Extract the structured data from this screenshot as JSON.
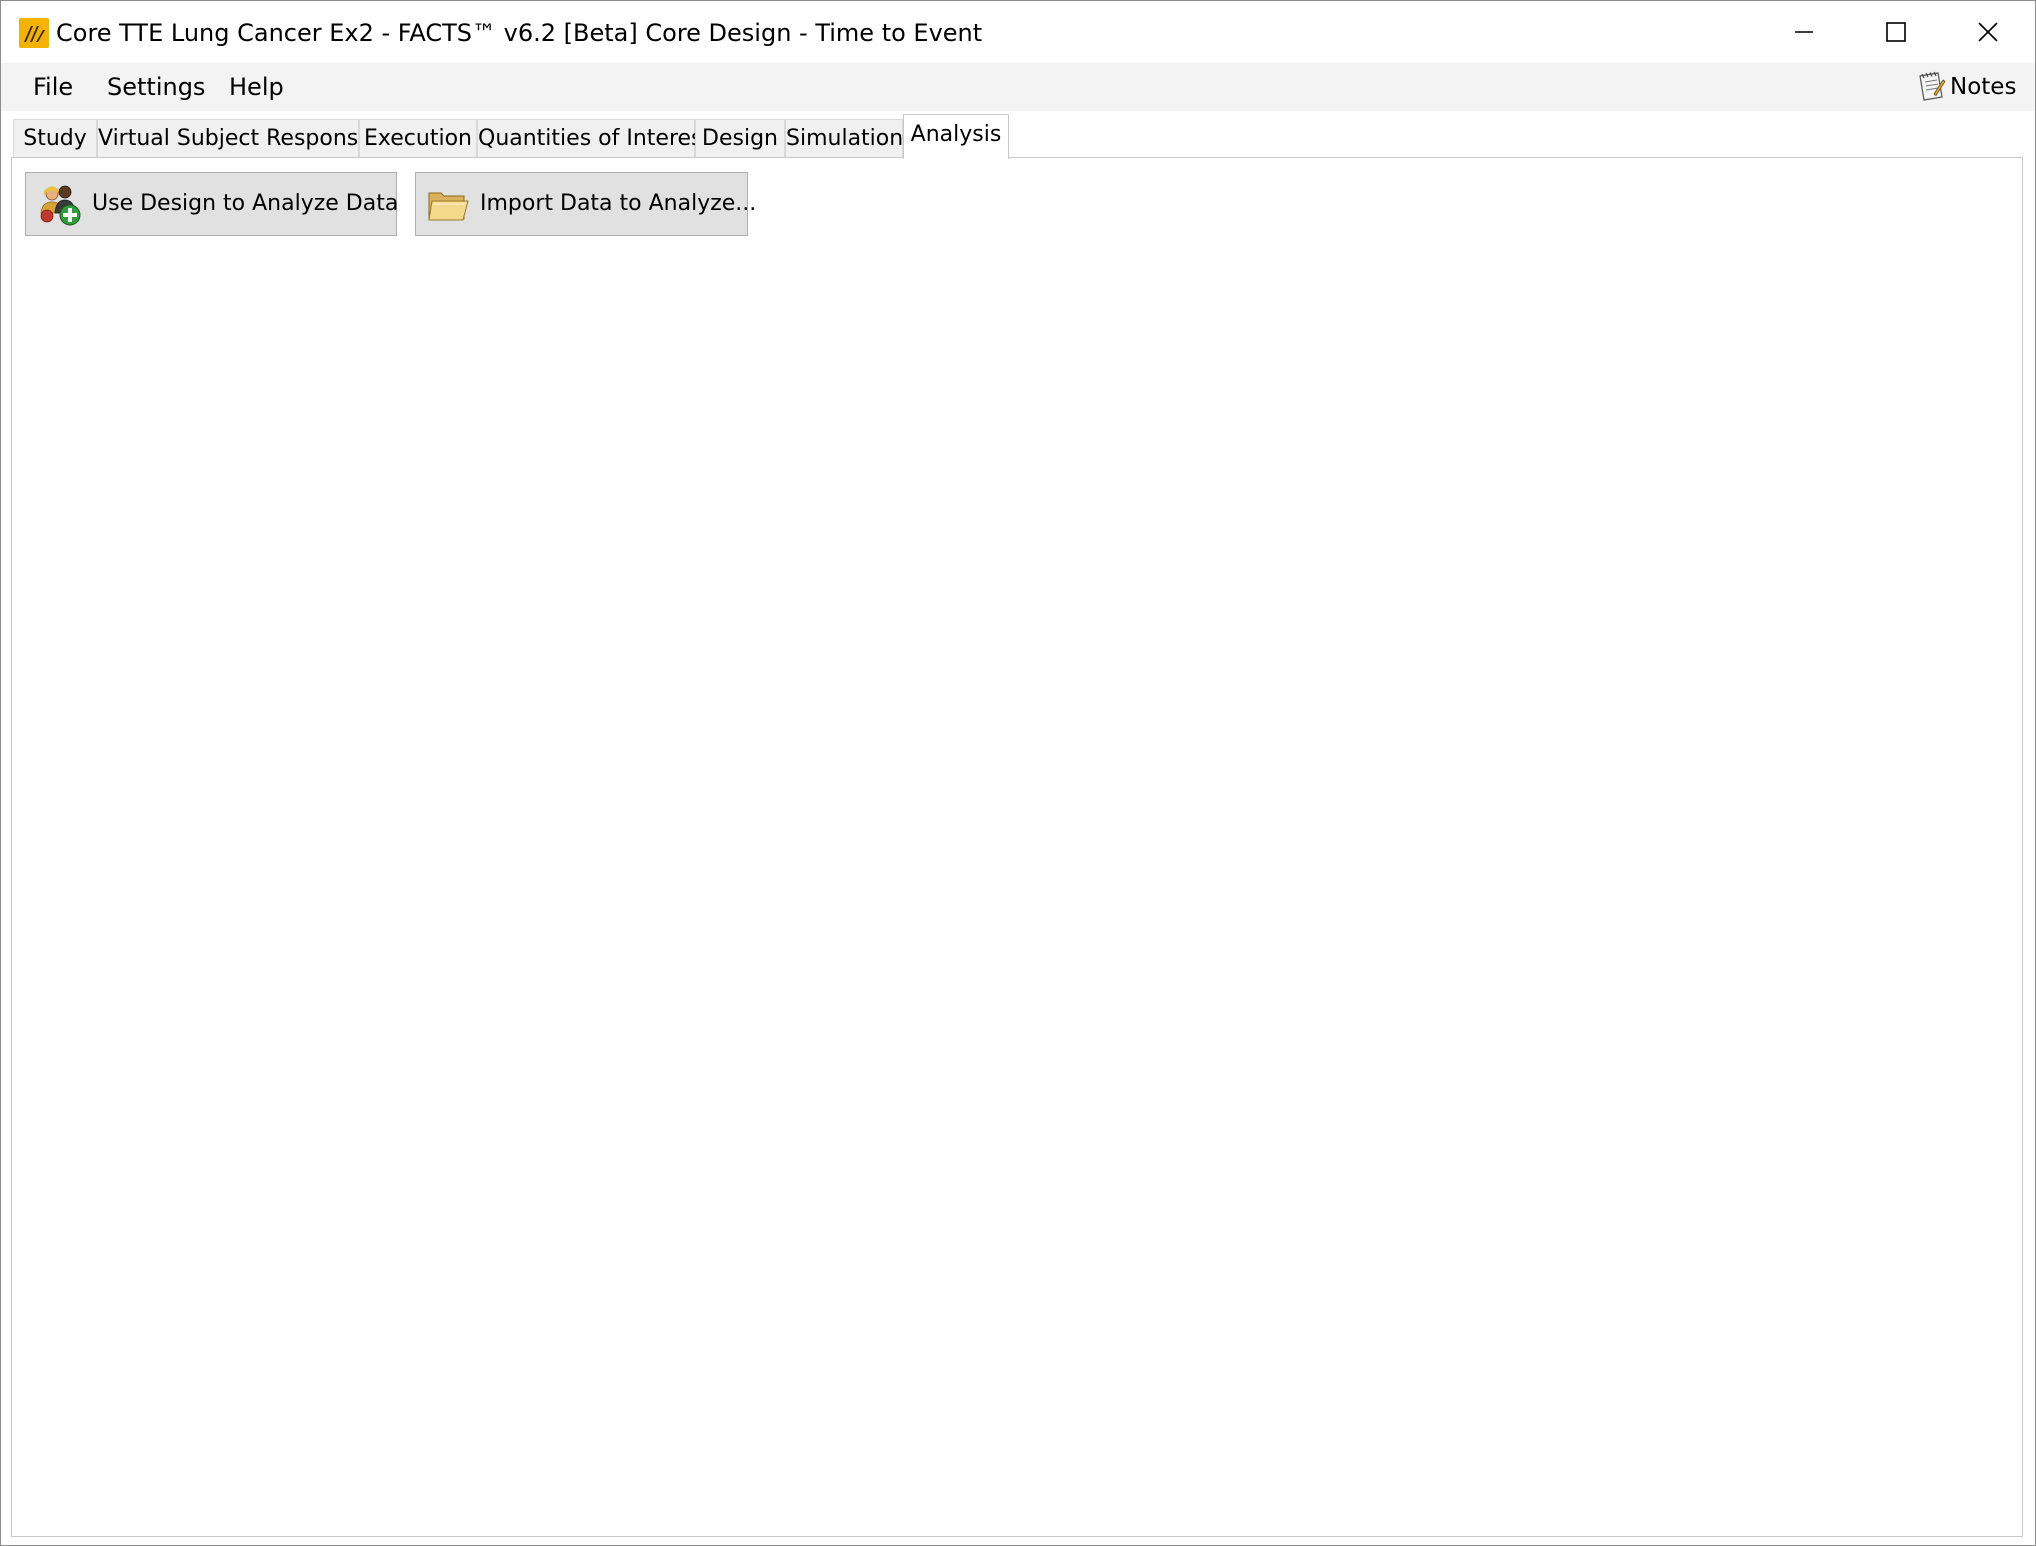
{
  "window": {
    "title": "Core TTE Lung Cancer Ex2 - FACTS™ v6.2 [Beta] Core Design - Time to Event",
    "icon": "facts-app-icon",
    "controls": [
      "minimize-icon",
      "maximize-icon",
      "close-icon"
    ]
  },
  "menu": {
    "items": [
      {
        "label": "File"
      },
      {
        "label": "Settings"
      },
      {
        "label": "Help"
      }
    ],
    "notes_label": "Notes",
    "notes_icon": "notepad-icon"
  },
  "tabs": [
    {
      "label": "Study",
      "active": false
    },
    {
      "label": "Virtual Subject Response",
      "active": false
    },
    {
      "label": "Execution",
      "active": false
    },
    {
      "label": "Quantities of Interest",
      "active": false
    },
    {
      "label": "Design",
      "active": false
    },
    {
      "label": "Simulation",
      "active": false
    },
    {
      "label": "Analysis",
      "active": true
    }
  ],
  "analysis": {
    "use_design_label": "Use Design to Analyze Data",
    "use_design_icon": "users-add-icon",
    "import_label": "Import Data to Analyze...",
    "import_icon": "folder-open-icon"
  },
  "colors": {
    "app_icon": "#f5b301",
    "menu_bg": "#f3f3f3",
    "button_bg": "#e1e1e1"
  }
}
